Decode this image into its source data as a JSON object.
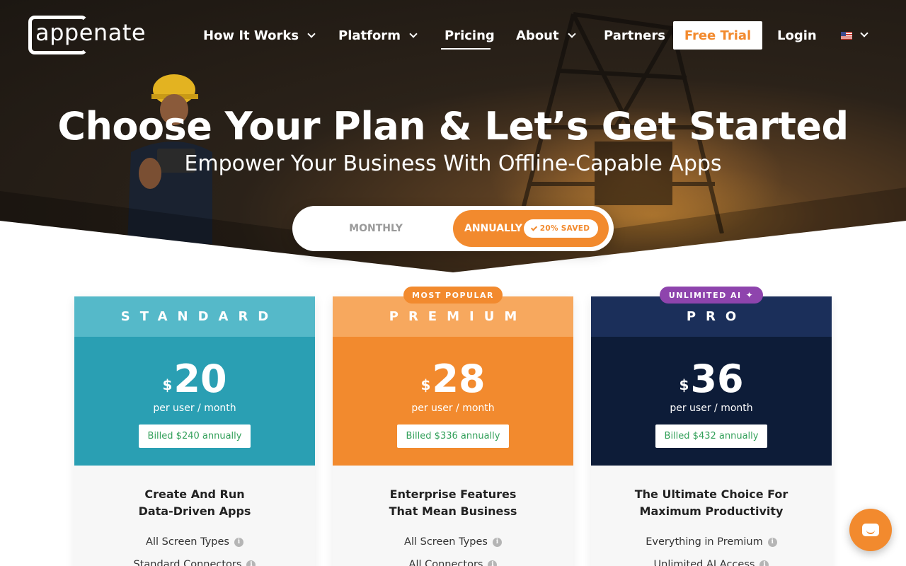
{
  "brand": {
    "logo_text": "appenate"
  },
  "nav": {
    "items": [
      {
        "label": "How It Works",
        "dropdown": true
      },
      {
        "label": "Platform",
        "dropdown": true
      },
      {
        "label": "Pricing",
        "dropdown": false,
        "active": true
      },
      {
        "label": "About",
        "dropdown": true
      },
      {
        "label": "Partners",
        "dropdown": false
      }
    ],
    "cta_label": "Free Trial",
    "login_label": "Login",
    "language_icon": "us-flag-icon"
  },
  "hero": {
    "title": "Choose Your Plan & Let’s Get Started",
    "subtitle": "Empower Your Business With Offline-Capable Apps"
  },
  "billing_toggle": {
    "monthly_label": "MONTHLY",
    "annual_label": "ANNUALLY",
    "savings_label": "20% SAVED",
    "selected": "annually"
  },
  "plans": [
    {
      "name": "STANDARD",
      "currency": "$",
      "price": "20",
      "period": "per user / month",
      "billed": "Billed $240 annually",
      "tagline_1": "Create And Run",
      "tagline_2": "Data-Driven Apps",
      "features": [
        "All Screen Types",
        "Standard Connectors"
      ],
      "header_color": "#55b9c9",
      "price_color": "#2a9fb3"
    },
    {
      "name": "PREMIUM",
      "badge": "MOST POPULAR",
      "currency": "$",
      "price": "28",
      "period": "per user / month",
      "billed": "Billed $336 annually",
      "tagline_1": "Enterprise Features",
      "tagline_2": "That Mean Business",
      "features": [
        "All Screen Types",
        "All Connectors"
      ],
      "header_color": "#f7a85e",
      "price_color": "#f28a2e"
    },
    {
      "name": "PRO",
      "badge": "UNLIMITED AI",
      "currency": "$",
      "price": "36",
      "period": "per user / month",
      "billed": "Billed $432 annually",
      "tagline_1": "The Ultimate Choice For",
      "tagline_2": "Maximum Productivity",
      "features": [
        "Everything in Premium",
        "Unlimited AI Access"
      ],
      "header_color": "#1b2f5a",
      "price_color": "#0d1c38"
    }
  ],
  "colors": {
    "accent": "#f28a2e",
    "billed_text": "#33a05a",
    "ai_badge": "#8e44ad"
  }
}
